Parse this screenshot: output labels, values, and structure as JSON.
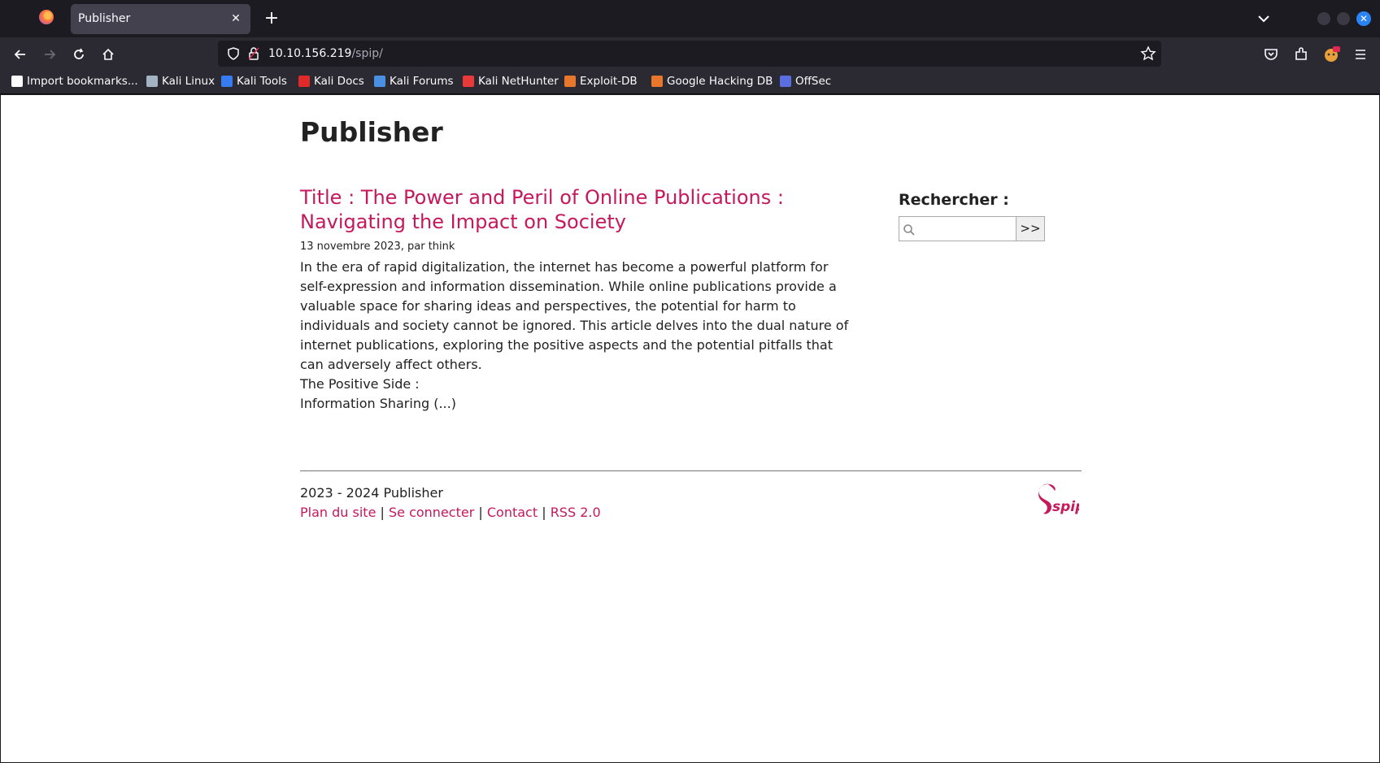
{
  "browser": {
    "tab_title": "Publisher",
    "url_host": "10.10.156.219",
    "url_path": "/spip/",
    "bookmarks": [
      {
        "label": "Import bookmarks...",
        "color": "#fbfbfe"
      },
      {
        "label": "Kali Linux",
        "color": "#a3b3c2"
      },
      {
        "label": "Kali Tools",
        "color": "#367bf0"
      },
      {
        "label": "Kali Docs",
        "color": "#e02a2a"
      },
      {
        "label": "Kali Forums",
        "color": "#4a90e2"
      },
      {
        "label": "Kali NetHunter",
        "color": "#e83a3a"
      },
      {
        "label": "Exploit-DB",
        "color": "#e8772e"
      },
      {
        "label": "Google Hacking DB",
        "color": "#e8772e"
      },
      {
        "label": "OffSec",
        "color": "#5b6ee1"
      }
    ]
  },
  "page": {
    "site_title": "Publisher",
    "article": {
      "title": "Title : The Power and Peril of Online Publications : Navigating the Impact on Society",
      "meta": "13 novembre 2023, par think",
      "body": "In the era of rapid digitalization, the internet has become a powerful platform for self-expression and information dissemination. While online publications provide a valuable space for sharing ideas and perspectives, the potential for harm to individuals and society cannot be ignored. This article delves into the dual nature of internet publications, exploring the positive aspects and the potential pitfalls that can adversely affect others.",
      "line2": "The Positive Side :",
      "line3": "Information Sharing (...)"
    },
    "search": {
      "label": "Rechercher :",
      "placeholder": "",
      "button": ">>"
    },
    "footer": {
      "copyright": "2023 - 2024 Publisher",
      "links": [
        "Plan du site",
        "Se connecter",
        "Contact",
        "RSS 2.0"
      ],
      "separator": "|",
      "logo_text": "spip"
    }
  },
  "colors": {
    "accent": "#c5185d",
    "page_bg": "#ffffff",
    "chrome_bg": "#2b2a33"
  }
}
